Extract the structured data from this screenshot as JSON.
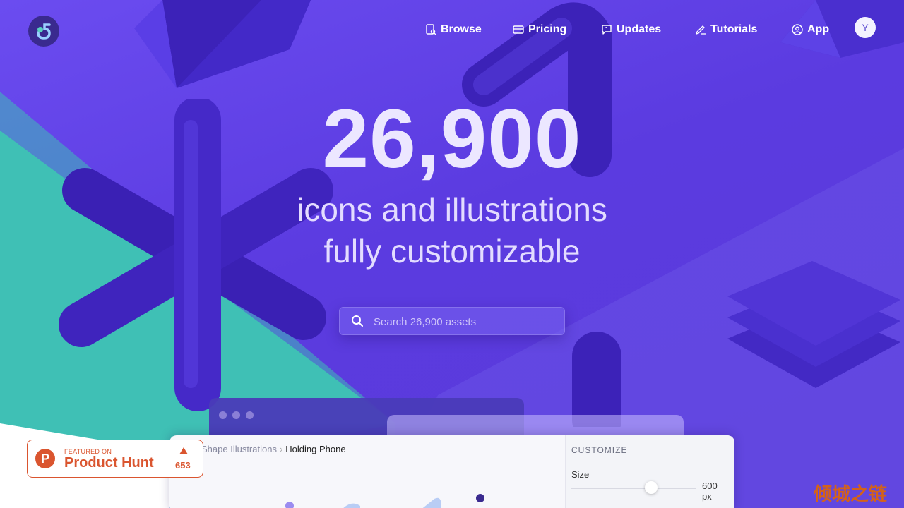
{
  "nav": {
    "items": [
      {
        "label": "Browse",
        "icon": "document-search-icon"
      },
      {
        "label": "Pricing",
        "icon": "credit-card-icon"
      },
      {
        "label": "Updates",
        "icon": "chat-quote-icon"
      },
      {
        "label": "Tutorials",
        "icon": "pen-icon"
      },
      {
        "label": "App",
        "icon": "user-circle-icon"
      }
    ],
    "avatar_initial": "Y"
  },
  "hero": {
    "count": "26,900",
    "line1": "icons and illustrations",
    "line2": "fully customizable"
  },
  "search": {
    "placeholder": "Search 26,900 assets"
  },
  "mockup": {
    "breadcrumb_parent": "Shape Illustrations",
    "breadcrumb_current": "Holding Phone",
    "customize_title": "CUSTOMIZE",
    "size_label": "Size",
    "size_value": "600",
    "size_unit": "px"
  },
  "product_hunt": {
    "featured_text": "FEATURED ON",
    "name": "Product Hunt",
    "votes": "653"
  },
  "watermark": "倾城之链",
  "colors": {
    "background": "#6b4cf0",
    "teal": "#3fc3b6",
    "accent": "#da552f",
    "shape": "#4a2fd0"
  }
}
